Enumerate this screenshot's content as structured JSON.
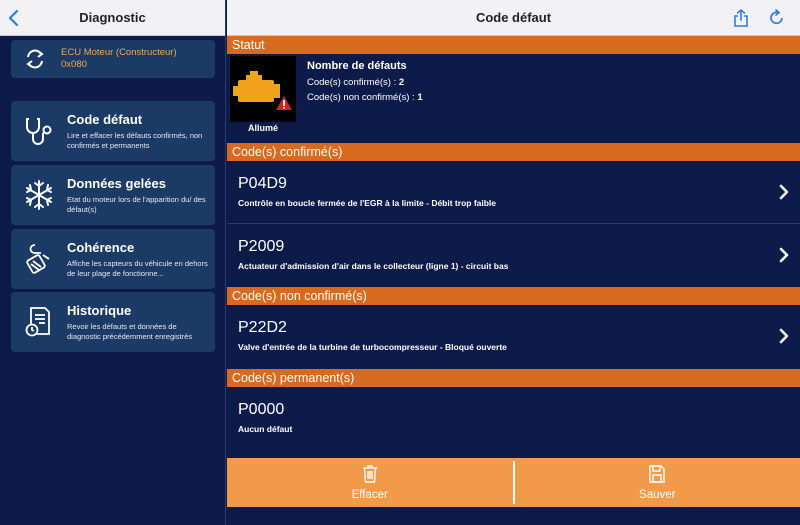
{
  "sidebar": {
    "title": "Diagnostic",
    "ecu": {
      "name": "ECU Moteur (Constructeur)",
      "address": "0x080"
    },
    "items": [
      {
        "title": "Code défaut",
        "desc": "Lire et effacer les défauts confirmés, non confirmés et permanents",
        "icon": "stethoscope-icon"
      },
      {
        "title": "Données gelées",
        "desc": "Etat du moteur lors de l'apparition du/ des défaut(s)",
        "icon": "snowflake-icon"
      },
      {
        "title": "Cohérence",
        "desc": "Affiche les capteurs du véhicule en dehors de leur plage de fonctionne...",
        "icon": "sensor-icon"
      },
      {
        "title": "Historique",
        "desc": "Revoir les défauts et données de diagnostic précédemment enregistrés",
        "icon": "history-document-icon"
      }
    ]
  },
  "header": {
    "title": "Code défaut"
  },
  "status": {
    "section": "Statut",
    "engine_state": "Allumé",
    "title": "Nombre de défauts",
    "confirmed_label": "Code(s) confirmé(s) : ",
    "confirmed_count": "2",
    "unconfirmed_label": "Code(s) non confirmé(s) : ",
    "unconfirmed_count": "1"
  },
  "confirmed": {
    "section": "Code(s) confirmé(s)",
    "codes": [
      {
        "code": "P04D9",
        "desc": "Contrôle en boucle fermée de l'EGR à la limite - Débit trop faible"
      },
      {
        "code": "P2009",
        "desc": "Actuateur d'admission d'air dans le collecteur (ligne 1) - circuit bas"
      }
    ]
  },
  "unconfirmed": {
    "section": "Code(s) non confirmé(s)",
    "codes": [
      {
        "code": "P22D2",
        "desc": "Valve d'entrée de la turbine de turbocompresseur - Bloqué ouverte"
      }
    ]
  },
  "permanent": {
    "section": "Code(s) permanent(s)",
    "codes": [
      {
        "code": "P0000",
        "desc": "Aucun défaut"
      }
    ]
  },
  "actions": {
    "erase": "Effacer",
    "save": "Sauver"
  },
  "colors": {
    "background": "#0d1b4a",
    "card": "#1b3b66",
    "section": "#d86a1f",
    "bottom": "#f09a4a",
    "accent": "#2f7de1",
    "ecu_text": "#e9a85a"
  }
}
